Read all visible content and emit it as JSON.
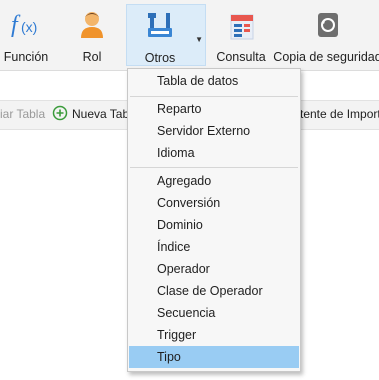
{
  "ribbon": {
    "buttons": [
      {
        "label": "Función",
        "icon": "function-icon"
      },
      {
        "label": "Rol",
        "icon": "user-icon"
      },
      {
        "label": "Otros",
        "icon": "tools-icon"
      },
      {
        "label": "Consulta",
        "icon": "query-icon"
      },
      {
        "label": "Copia de seguridad",
        "icon": "backup-icon"
      }
    ]
  },
  "subbar": {
    "edit_table": "iar Tabla",
    "new_table": "Nueva Tab",
    "import_wizard": "tente de Import"
  },
  "menu": {
    "items": [
      "Tabla de datos",
      "Reparto",
      "Servidor Externo",
      "Idioma",
      "Agregado",
      "Conversión",
      "Dominio",
      "Índice",
      "Operador",
      "Clase de Operador",
      "Secuencia",
      "Trigger",
      "Tipo"
    ],
    "selected": "Tipo"
  },
  "colors": {
    "accent_active": "#dcecf9",
    "menu_highlight": "#99ccf3"
  }
}
